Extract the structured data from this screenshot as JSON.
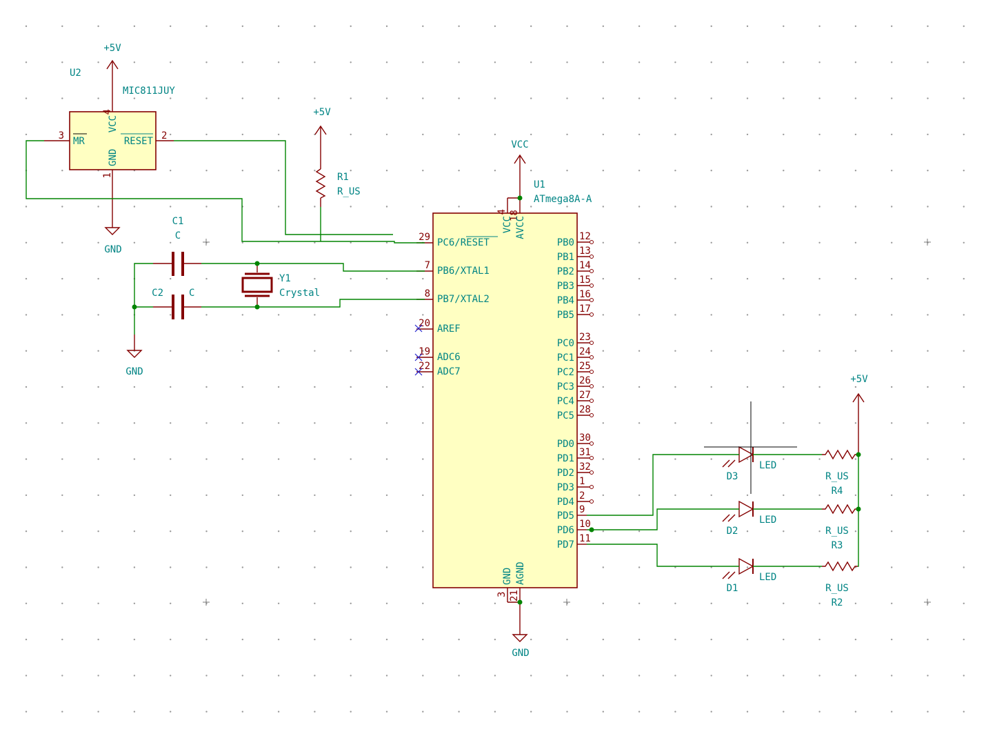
{
  "components": {
    "U2": {
      "ref": "U2",
      "value": "MIC811JUY",
      "pins": {
        "mr_name": "MR",
        "mr_num": "3",
        "vcc_name": "VCC",
        "vcc_num": "4",
        "reset_name": "RESET",
        "reset_num": "2",
        "gnd_name": "GND",
        "gnd_num": "1"
      }
    },
    "U1": {
      "ref": "U1",
      "value": "ATmega8A-A",
      "left_pins": [
        {
          "name": "PC6/RESET",
          "num": "29"
        },
        {
          "name": "PB6/XTAL1",
          "num": "7"
        },
        {
          "name": "PB7/XTAL2",
          "num": "8"
        },
        {
          "name": "AREF",
          "num": "20"
        },
        {
          "name": "ADC6",
          "num": "19"
        },
        {
          "name": "ADC7",
          "num": "22"
        }
      ],
      "right_pins": [
        {
          "name": "PB0",
          "num": "12"
        },
        {
          "name": "PB1",
          "num": "13"
        },
        {
          "name": "PB2",
          "num": "14"
        },
        {
          "name": "PB3",
          "num": "15"
        },
        {
          "name": "PB4",
          "num": "16"
        },
        {
          "name": "PB5",
          "num": "17"
        },
        {
          "name": "PC0",
          "num": "23"
        },
        {
          "name": "PC1",
          "num": "24"
        },
        {
          "name": "PC2",
          "num": "25"
        },
        {
          "name": "PC3",
          "num": "26"
        },
        {
          "name": "PC4",
          "num": "27"
        },
        {
          "name": "PC5",
          "num": "28"
        },
        {
          "name": "PD0",
          "num": "30"
        },
        {
          "name": "PD1",
          "num": "31"
        },
        {
          "name": "PD2",
          "num": "32"
        },
        {
          "name": "PD3",
          "num": "1"
        },
        {
          "name": "PD4",
          "num": "2"
        },
        {
          "name": "PD5",
          "num": "9"
        },
        {
          "name": "PD6",
          "num": "10"
        },
        {
          "name": "PD7",
          "num": "11"
        }
      ],
      "top_pins": [
        {
          "name": "VCC",
          "num": "4"
        },
        {
          "name": "AVCC",
          "num": "18"
        }
      ],
      "bottom_pins": [
        {
          "name": "GND",
          "num": "3"
        },
        {
          "name": "AGND",
          "num": "21"
        }
      ]
    },
    "R1": {
      "ref": "R1",
      "value": "R_US"
    },
    "C1": {
      "ref": "C1",
      "value": "C"
    },
    "C2": {
      "ref": "C2",
      "value": "C"
    },
    "Y1": {
      "ref": "Y1",
      "value": "Crystal"
    },
    "D1": {
      "ref": "D1",
      "value": "LED"
    },
    "D2": {
      "ref": "D2",
      "value": "LED"
    },
    "D3": {
      "ref": "D3",
      "value": "LED"
    },
    "R2": {
      "ref": "R2",
      "value": "R_US"
    },
    "R3": {
      "ref": "R3",
      "value": "R_US"
    },
    "R4": {
      "ref": "R4",
      "value": "R_US"
    }
  },
  "power": {
    "p5v_u2": "+5V",
    "p5v_r1": "+5V",
    "p5v_leds": "+5V",
    "vcc_u1": "VCC",
    "gnd_u2": "GND",
    "gnd_caps": "GND",
    "gnd_u1": "GND"
  }
}
